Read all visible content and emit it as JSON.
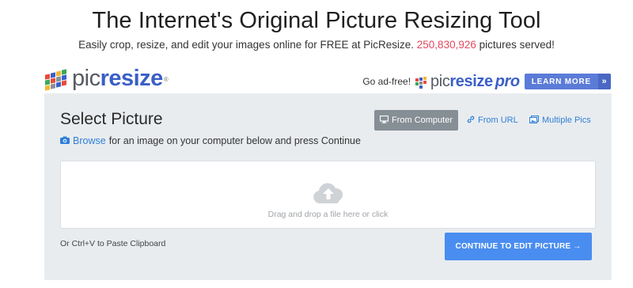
{
  "header": {
    "title": "The Internet's Original Picture Resizing Tool",
    "subtitle_prefix": "Easily crop, resize, and edit your images online for FREE at PicResize.",
    "pictures_count": "250,830,926",
    "subtitle_suffix": "pictures served!"
  },
  "logo": {
    "pic": "pic",
    "resize": "resize",
    "reg": "®"
  },
  "ad": {
    "go_ad_free": "Go ad-free!",
    "pro_pic": "pic",
    "pro_resize": "resize",
    "pro_label": "pro",
    "learn_more": "LEARN MORE",
    "chevron": "»"
  },
  "panel": {
    "title": "Select Picture",
    "tabs": {
      "computer": "From Computer",
      "url": "From URL",
      "multiple": "Multiple Pics"
    },
    "browse_link": "Browse",
    "browse_text": "for an image on your computer below and press Continue",
    "drop_text": "Drag and drop a file here or click",
    "paste_text": "Or Ctrl+V to Paste Clipboard",
    "continue_label": "CONTINUE TO EDIT PICTURE →"
  },
  "colors": {
    "accent": "#4a8df0",
    "count": "#e0495d",
    "brand": "#3a5fc8",
    "active_tab": "#868e96"
  },
  "icons": {
    "computer": "desktop-icon",
    "url": "link-icon",
    "multiple": "images-icon",
    "browse": "camera-icon",
    "upload": "cloud-upload-icon"
  }
}
